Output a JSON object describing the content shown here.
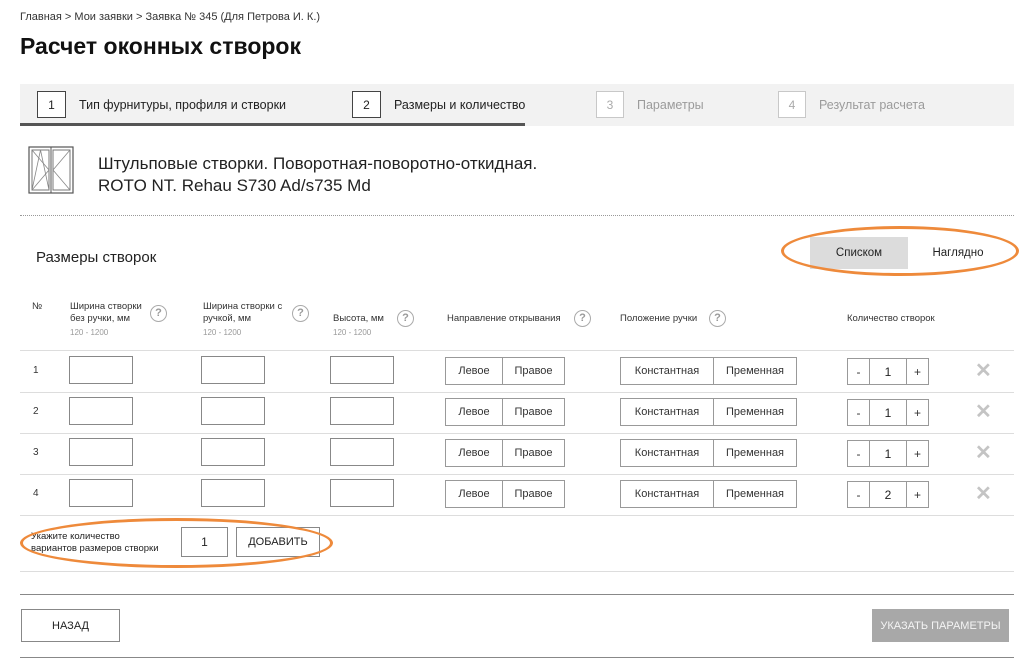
{
  "breadcrumb": "Главная > Мои заявки > Заявка № 345 (Для Петрова И. К.)",
  "page_title": "Расчет оконных створок",
  "steps": [
    {
      "num": "1",
      "label": "Тип фурнитуры, профиля и створки"
    },
    {
      "num": "2",
      "label": "Размеры и количество"
    },
    {
      "num": "3",
      "label": "Параметры"
    },
    {
      "num": "4",
      "label": "Результат расчета"
    }
  ],
  "product": {
    "line1": "Штульповые створки. Поворотная-поворотно-откидная.",
    "line2": "ROTO NT. Rehau S730 Ad/s735 Md"
  },
  "section_title": "Размеры створок",
  "view_toggle": {
    "list": "Списком",
    "visual": "Наглядно",
    "selected": "Списком"
  },
  "columns": {
    "num": "№",
    "width_no_handle": "Ширина створки без ручки, мм",
    "width_no_handle_range": "120 - 1200",
    "width_handle": "Ширина створки с ручкой, мм",
    "width_handle_range": "120 - 1200",
    "height": "Высота, мм",
    "height_range": "120 - 1200",
    "direction": "Направление открывания",
    "handle_position": "Положение ручки",
    "quantity": "Количество створок"
  },
  "rows": [
    {
      "num": "1",
      "left": "Левое",
      "right": "Правое",
      "constant": "Константная",
      "temporary": "Пременная",
      "minus": "-",
      "qty": "1",
      "plus": "+"
    },
    {
      "num": "2",
      "left": "Левое",
      "right": "Правое",
      "constant": "Константная",
      "temporary": "Пременная",
      "minus": "-",
      "qty": "1",
      "plus": "+"
    },
    {
      "num": "3",
      "left": "Левое",
      "right": "Правое",
      "constant": "Константная",
      "temporary": "Пременная",
      "minus": "-",
      "qty": "1",
      "plus": "+"
    },
    {
      "num": "4",
      "left": "Левое",
      "right": "Правое",
      "constant": "Константная",
      "temporary": "Пременная",
      "minus": "-",
      "qty": "2",
      "plus": "+"
    }
  ],
  "add_variants": {
    "label_line1": "Укажите количество",
    "label_line2": "вариантов размеров створки",
    "value": "1",
    "button": "ДОБАВИТЬ"
  },
  "buttons": {
    "back": "НАЗАД",
    "next": "УКАЗАТЬ ПАРАМЕТРЫ"
  },
  "icons": {
    "help": "question-circle-icon",
    "delete": "cross-icon",
    "product": "window-sash-icon"
  },
  "colors": {
    "highlight": "#ee8a3b",
    "disabled_button": "#a8a8a8",
    "delete_icon": "#c4c4c4"
  }
}
